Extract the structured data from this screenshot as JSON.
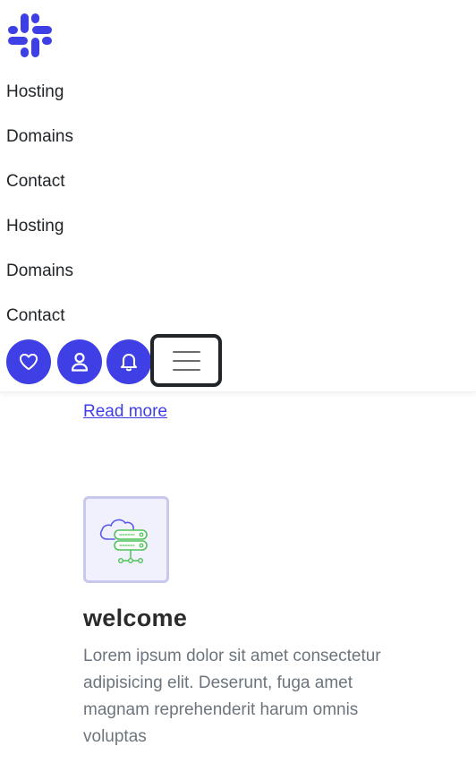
{
  "brand": {
    "logo_icon": "slack-like-hash-logo",
    "accent_color": "#3f3fe6"
  },
  "nav": {
    "links": [
      {
        "label": "Hosting"
      },
      {
        "label": "Domains"
      },
      {
        "label": "Contact"
      },
      {
        "label": "Hosting"
      },
      {
        "label": "Domains"
      },
      {
        "label": "Contact"
      }
    ]
  },
  "actions": {
    "icons": [
      "heart-icon",
      "user-icon",
      "bell-icon"
    ],
    "menu_icon": "hamburger-icon"
  },
  "content": {
    "read_more": "Read more",
    "card": {
      "icon": "cloud-server-icon",
      "title": "welcome",
      "text": "Lorem ipsum dolor sit amet consectetur adipisicing elit. Deserunt, fuga amet magnam reprehenderit harum omnis voluptas"
    }
  }
}
